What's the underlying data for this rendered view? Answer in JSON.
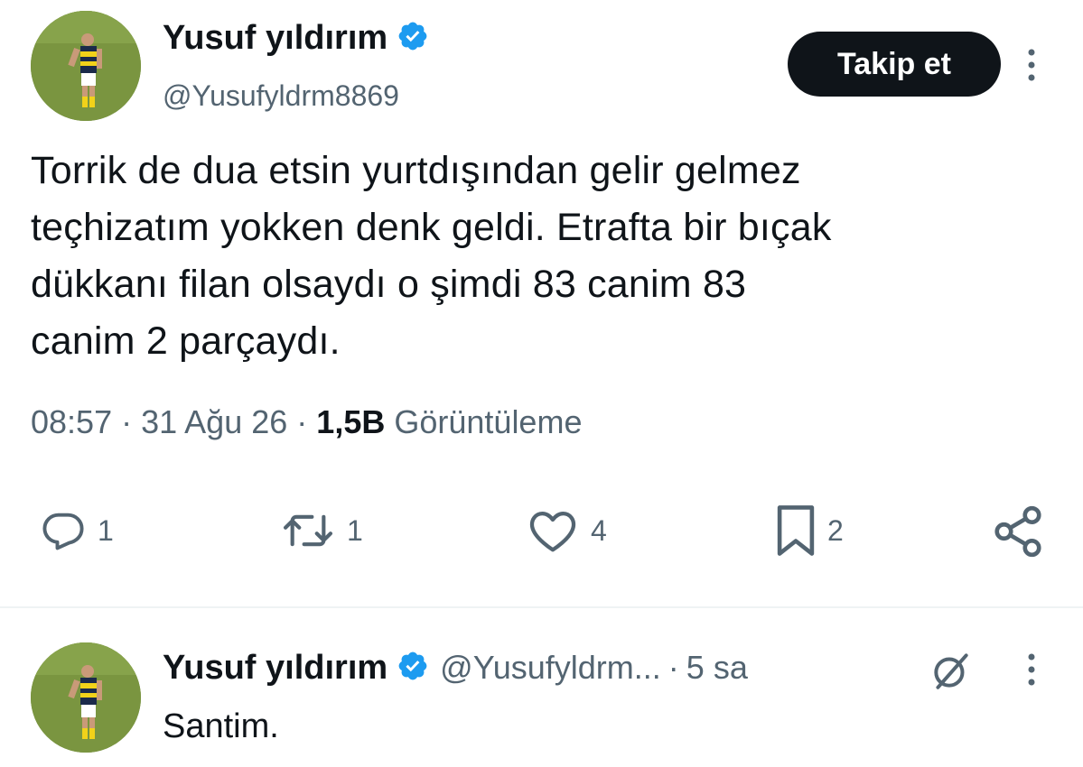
{
  "tweet": {
    "author": {
      "name": "Yusuf yıldırım",
      "handle": "@Yusufyldrm8869"
    },
    "follow_label": "Takip et",
    "text_lines": [
      "Torrik de dua etsin yurtdışından gelir gelmez",
      "teçhizatım yokken denk geldi. Etrafta bir bıçak",
      "dükkanı filan olsaydı o şimdi 83 canim 83",
      "canim 2 parçaydı."
    ],
    "time": "08:57",
    "date": "31 Ağu 26",
    "views_count": "1,5B",
    "views_label": "Görüntüleme",
    "actions": {
      "replies": "1",
      "reposts": "1",
      "likes": "4",
      "bookmarks": "2"
    }
  },
  "reply": {
    "author": {
      "name": "Yusuf yıldırım",
      "handle": "@Yusufyldrm..."
    },
    "age": "5 sa",
    "text": "Santim."
  },
  "icons": {
    "verified": "verified-badge-icon",
    "more": "more-vertical-icon",
    "reply": "reply-icon",
    "repost": "repost-icon",
    "like": "heart-icon",
    "bookmark": "bookmark-icon",
    "share": "share-icon",
    "grok": "grok-icon"
  },
  "colors": {
    "verified": "#1d9bf0",
    "text": "#0f1419",
    "secondary": "#536471"
  }
}
